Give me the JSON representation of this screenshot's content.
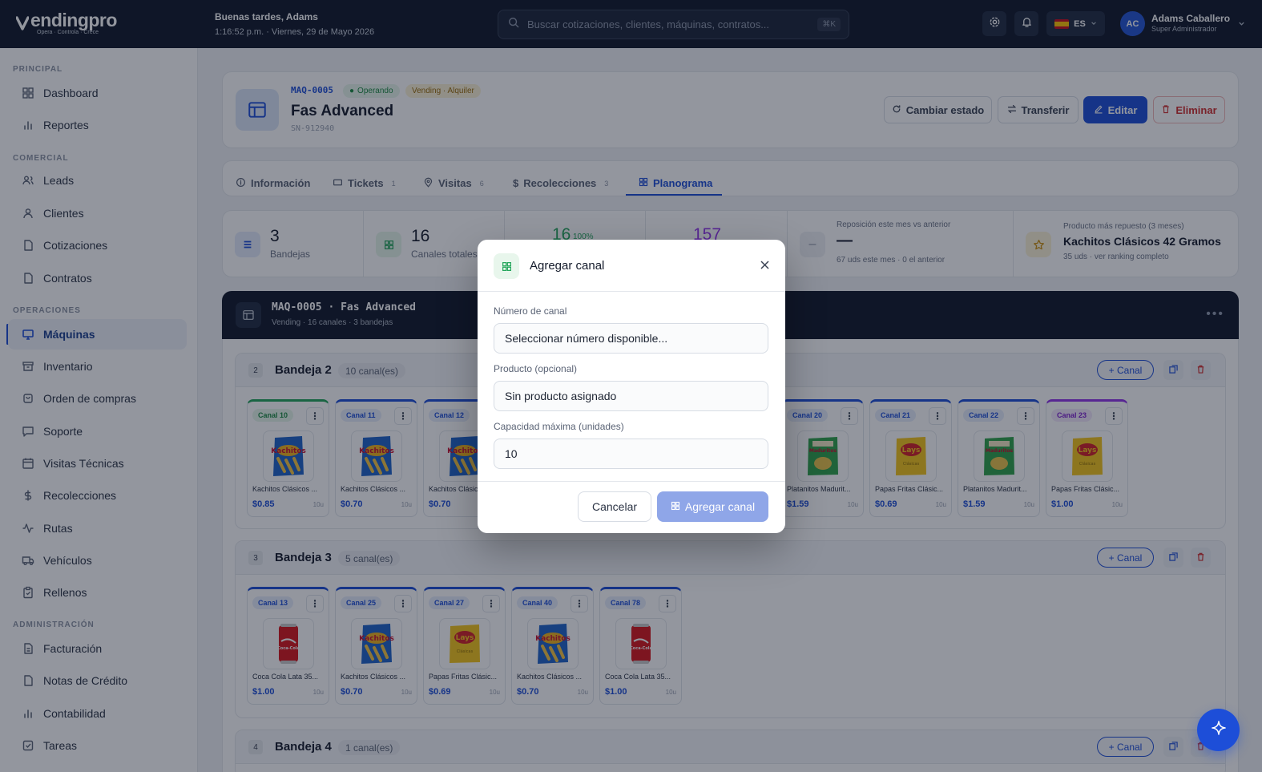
{
  "brand": {
    "name": "endingpro",
    "tagline": "Opera · Controla · Crece"
  },
  "header": {
    "greeting": "Buenas tardes, Adams",
    "datetime": "1:16:52 p.m. · Viernes, 29 de Mayo 2026",
    "search_placeholder": "Buscar cotizaciones, clientes, máquinas, contratos...",
    "shortcut": "⌘K",
    "language": "ES",
    "user": {
      "initials": "AC",
      "name": "Adams Caballero",
      "role": "Super Administrador"
    }
  },
  "sidebar": {
    "sections": [
      "PRINCIPAL",
      "COMERCIAL",
      "OPERACIONES",
      "ADMINISTRACIÓN"
    ],
    "items": [
      {
        "label": "Dashboard",
        "icon": "grid-icon"
      },
      {
        "label": "Reportes",
        "icon": "bar-chart-icon"
      },
      {
        "label": "Leads",
        "icon": "users-icon"
      },
      {
        "label": "Clientes",
        "icon": "user-icon"
      },
      {
        "label": "Cotizaciones",
        "icon": "file-icon"
      },
      {
        "label": "Contratos",
        "icon": "file-icon"
      },
      {
        "label": "Máquinas",
        "icon": "monitor-icon",
        "active": true
      },
      {
        "label": "Inventario",
        "icon": "archive-icon"
      },
      {
        "label": "Orden de compras",
        "icon": "cart-icon"
      },
      {
        "label": "Soporte",
        "icon": "message-icon"
      },
      {
        "label": "Visitas Técnicas",
        "icon": "calendar-icon"
      },
      {
        "label": "Recolecciones",
        "icon": "dollar-icon"
      },
      {
        "label": "Rutas",
        "icon": "activity-icon"
      },
      {
        "label": "Vehículos",
        "icon": "truck-icon"
      },
      {
        "label": "Rellenos",
        "icon": "clipboard-icon"
      },
      {
        "label": "Facturación",
        "icon": "receipt-icon"
      },
      {
        "label": "Notas de Crédito",
        "icon": "file-icon"
      },
      {
        "label": "Contabilidad",
        "icon": "bar-chart-icon"
      },
      {
        "label": "Tareas",
        "icon": "check-square-icon"
      }
    ]
  },
  "machine": {
    "code": "MAQ-0005",
    "status": "Operando",
    "type": "Vending · Alquiler",
    "name": "Fas Advanced",
    "serial": "SN-912940",
    "actions": {
      "change_state": "Cambiar estado",
      "transfer": "Transferir",
      "edit": "Editar",
      "delete": "Eliminar"
    }
  },
  "tabs": [
    {
      "label": "Información",
      "count": ""
    },
    {
      "label": "Tickets",
      "count": "1"
    },
    {
      "label": "Visitas",
      "count": "6"
    },
    {
      "label": "Recolecciones",
      "count": "3"
    },
    {
      "label": "Planograma",
      "count": "",
      "active": true
    }
  ],
  "stats": {
    "trays": {
      "value": "3",
      "label": "Bandejas"
    },
    "channels": {
      "value": "16",
      "label": "Canales totales"
    },
    "active": {
      "value": "16",
      "pct": "100%"
    },
    "units": {
      "value": "157"
    },
    "restock": {
      "title": "Reposición este mes vs anterior",
      "value": "—",
      "detail": "67 uds este mes · 0 el anterior"
    },
    "top_product": {
      "title": "Producto más repuesto (3 meses)",
      "name": "Kachitos Clásicos 42 Gramos",
      "detail": "35 uds · ver ranking completo"
    }
  },
  "planogram": {
    "title": "MAQ-0005 · Fas Advanced",
    "subtitle": "Vending · 16 canales · 3 bandejas",
    "add_channel_label": "+ Canal",
    "trays": [
      {
        "num": "2",
        "name": "Bandeja 2",
        "count": "10 canal(es)",
        "slots": [
          {
            "tag": "Canal 10",
            "name": "Kachitos Clásicos ...",
            "price": "$0.85",
            "cap": "10u",
            "product": "kachitos",
            "accent": "#22a55a"
          },
          {
            "tag": "Canal 11",
            "name": "Kachitos Clásicos ...",
            "price": "$0.70",
            "cap": "10u",
            "product": "kachitos",
            "accent": "#1d4ed8"
          },
          {
            "tag": "Canal 12",
            "name": "Kachitos Clásicos ...",
            "price": "$0.70",
            "cap": "10u",
            "product": "kachitos",
            "accent": "#1d4ed8"
          },
          {
            "tag": "Canal 20",
            "name": "Platanitos Madurit...",
            "price": "$1.59",
            "cap": "10u",
            "product": "platanitos",
            "accent": "#1d4ed8"
          },
          {
            "tag": "Canal 21",
            "name": "Papas Fritas Clásic...",
            "price": "$0.69",
            "cap": "10u",
            "product": "lays",
            "accent": "#1d4ed8"
          },
          {
            "tag": "Canal 22",
            "name": "Platanitos Madurit...",
            "price": "$1.59",
            "cap": "10u",
            "product": "platanitos",
            "accent": "#1d4ed8"
          },
          {
            "tag": "Canal 23",
            "name": "Papas Fritas Clásic...",
            "price": "$1.00",
            "cap": "10u",
            "product": "lays",
            "accent": "#9333ea"
          }
        ]
      },
      {
        "num": "3",
        "name": "Bandeja 3",
        "count": "5 canal(es)",
        "slots": [
          {
            "tag": "Canal 13",
            "name": "Coca Cola Lata 35...",
            "price": "$1.00",
            "cap": "10u",
            "product": "coca",
            "accent": "#1d4ed8"
          },
          {
            "tag": "Canal 25",
            "name": "Kachitos Clásicos ...",
            "price": "$0.70",
            "cap": "10u",
            "product": "kachitos",
            "accent": "#1d4ed8"
          },
          {
            "tag": "Canal 27",
            "name": "Papas Fritas Clásic...",
            "price": "$0.69",
            "cap": "10u",
            "product": "lays",
            "accent": "#1d4ed8"
          },
          {
            "tag": "Canal 40",
            "name": "Kachitos Clásicos ...",
            "price": "$0.70",
            "cap": "10u",
            "product": "kachitos",
            "accent": "#1d4ed8"
          },
          {
            "tag": "Canal 78",
            "name": "Coca Cola Lata 35...",
            "price": "$1.00",
            "cap": "10u",
            "product": "coca",
            "accent": "#1d4ed8"
          }
        ]
      },
      {
        "num": "4",
        "name": "Bandeja 4",
        "count": "1 canal(es)",
        "slots": []
      }
    ]
  },
  "modal": {
    "title": "Agregar canal",
    "channel_label": "Número de canal",
    "channel_value": "Seleccionar número disponible...",
    "product_label": "Producto (opcional)",
    "product_value": "Sin producto asignado",
    "capacity_label": "Capacidad máxima (unidades)",
    "capacity_value": "10",
    "cancel": "Cancelar",
    "submit": "Agregar canal"
  }
}
